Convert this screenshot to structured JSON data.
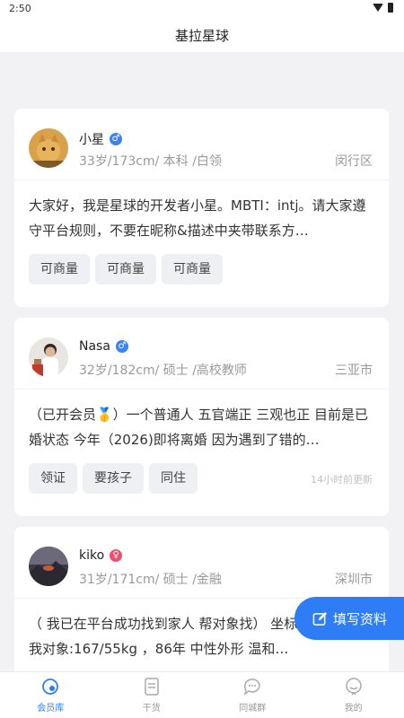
{
  "status_bar": {
    "time": "2:50"
  },
  "header": {
    "title": "基拉星球"
  },
  "members": [
    {
      "name": "小星",
      "gender": "male",
      "meta": "33岁/173cm/ 本科 /白领",
      "city": "闵行区",
      "intro": "大家好，我是星球的开发者小星。MBTI：intj。请大家遵守平台规则，不要在昵称&描述中夹带联系方…",
      "tags": [
        "可商量",
        "可商量",
        "可商量"
      ],
      "update": ""
    },
    {
      "name": "Nasa",
      "gender": "male",
      "meta": "32岁/182cm/ 硕士 /高校教师",
      "city": "三亚市",
      "intro": "（已开会员🥇）一个普通人 五官端正 三观也正 目前是已婚状态 今年（2026)即将离婚 因为遇到了错的…",
      "tags": [
        "领证",
        "要孩子",
        "同住"
      ],
      "update": "14小时前更新"
    },
    {
      "name": "kiko",
      "gender": "female",
      "meta": "31岁/171cm/ 硕士 /金融",
      "city": "深圳市",
      "intro": "（ 我已在平台成功找到家人 帮对象找） 坐标香港+深圳 我对象:167/55kg ，86年 中性外形 温和…",
      "tags": [],
      "update": ""
    }
  ],
  "fab": {
    "label": "填写资料"
  },
  "tabs": [
    {
      "label": "会员库",
      "active": true
    },
    {
      "label": "干货",
      "active": false
    },
    {
      "label": "同城群",
      "active": false
    },
    {
      "label": "我的",
      "active": false
    }
  ],
  "colors": {
    "accent": "#2f7df6",
    "male": "#3b82f6",
    "female": "#f0506e"
  },
  "icons": {
    "male": "male-symbol-icon",
    "female": "female-symbol-icon",
    "fab": "edit-icon"
  }
}
